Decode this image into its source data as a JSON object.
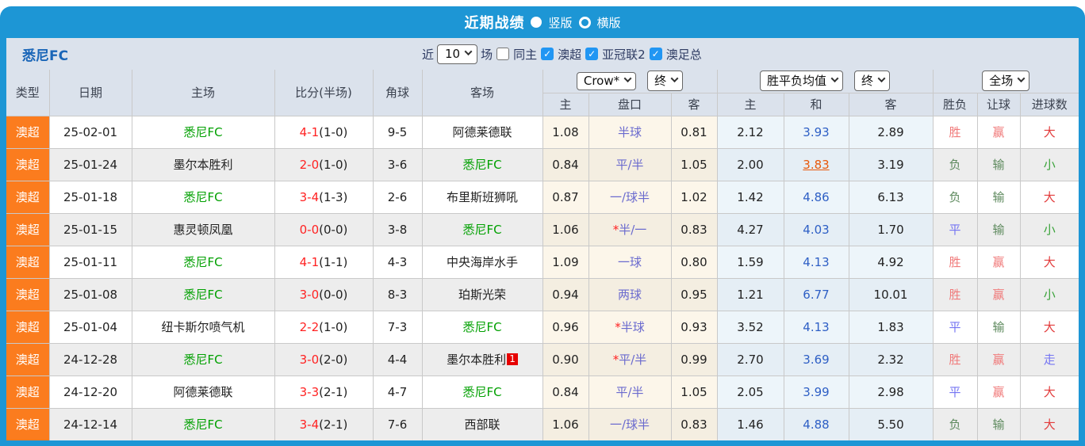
{
  "colors": {
    "frame_blue": "#1d96d5",
    "league_orange": "#fb7c1e",
    "team_green": "#00a000",
    "score_red": "#ff2222",
    "hot_orange": "#e8590c",
    "checkbox_blue": "#2196f3"
  },
  "header": {
    "title": "近期战绩",
    "radios": [
      {
        "label": "竖版",
        "selected": true
      },
      {
        "label": "横版",
        "selected": false
      }
    ]
  },
  "subheader": {
    "team": "悉尼FC",
    "near_label": "近",
    "count_value": "10",
    "games_label": "场",
    "checkboxes": [
      {
        "label": "同主",
        "checked": false
      },
      {
        "label": "澳超",
        "checked": true
      },
      {
        "label": "亚冠联2",
        "checked": true
      },
      {
        "label": "澳足总",
        "checked": true
      }
    ]
  },
  "table": {
    "main_headers": [
      "类型",
      "日期",
      "主场",
      "比分(半场)",
      "角球",
      "客场"
    ],
    "dropdowns": {
      "bookmaker": "Crow*",
      "final_a": "终",
      "avg": "胜平负均值",
      "final_b": "终",
      "scope": "全场"
    },
    "sub_headers": [
      "主",
      "盘口",
      "客",
      "主",
      "和",
      "客",
      "胜负",
      "让球",
      "进球数"
    ],
    "rows": [
      {
        "league": "澳超",
        "date": "25-02-01",
        "home": "悉尼FC",
        "hg": true,
        "score": "4-1",
        "half": "(1-0)",
        "corner": "9-5",
        "away": "阿德莱德联",
        "ag": false,
        "badge": "",
        "hh": "1.08",
        "hcap": "半球",
        "star": false,
        "ha": "0.81",
        "oh": "2.12",
        "od": "3.93",
        "hot": false,
        "oa": "2.89",
        "r1": {
          "t": "胜",
          "c": "r"
        },
        "r2": {
          "t": "赢",
          "c": "r"
        },
        "r3": {
          "t": "大",
          "c": "R"
        }
      },
      {
        "league": "澳超",
        "date": "25-01-24",
        "home": "墨尔本胜利",
        "hg": false,
        "score": "2-0",
        "half": "(1-0)",
        "corner": "3-6",
        "away": "悉尼FC",
        "ag": true,
        "badge": "",
        "hh": "0.84",
        "hcap": "平/半",
        "star": false,
        "ha": "1.05",
        "oh": "2.00",
        "od": "3.83",
        "hot": true,
        "oa": "3.19",
        "r1": {
          "t": "负",
          "c": "g"
        },
        "r2": {
          "t": "输",
          "c": "g"
        },
        "r3": {
          "t": "小",
          "c": "G"
        }
      },
      {
        "league": "澳超",
        "date": "25-01-18",
        "home": "悉尼FC",
        "hg": true,
        "score": "3-4",
        "half": "(1-3)",
        "corner": "2-6",
        "away": "布里斯班狮吼",
        "ag": false,
        "badge": "",
        "hh": "0.87",
        "hcap": "一/球半",
        "star": false,
        "ha": "1.02",
        "oh": "1.42",
        "od": "4.86",
        "hot": false,
        "oa": "6.13",
        "r1": {
          "t": "负",
          "c": "g"
        },
        "r2": {
          "t": "输",
          "c": "g"
        },
        "r3": {
          "t": "大",
          "c": "R"
        }
      },
      {
        "league": "澳超",
        "date": "25-01-15",
        "home": "惠灵顿凤凰",
        "hg": false,
        "score": "0-0",
        "half": "(0-0)",
        "corner": "3-8",
        "away": "悉尼FC",
        "ag": true,
        "badge": "",
        "hh": "1.06",
        "hcap": "半/一",
        "star": true,
        "ha": "0.83",
        "oh": "4.27",
        "od": "4.03",
        "hot": false,
        "oa": "1.70",
        "r1": {
          "t": "平",
          "c": "b"
        },
        "r2": {
          "t": "输",
          "c": "g"
        },
        "r3": {
          "t": "小",
          "c": "G"
        }
      },
      {
        "league": "澳超",
        "date": "25-01-11",
        "home": "悉尼FC",
        "hg": true,
        "score": "4-1",
        "half": "(1-1)",
        "corner": "4-3",
        "away": "中央海岸水手",
        "ag": false,
        "badge": "",
        "hh": "1.09",
        "hcap": "一球",
        "star": false,
        "ha": "0.80",
        "oh": "1.59",
        "od": "4.13",
        "hot": false,
        "oa": "4.92",
        "r1": {
          "t": "胜",
          "c": "r"
        },
        "r2": {
          "t": "赢",
          "c": "r"
        },
        "r3": {
          "t": "大",
          "c": "R"
        }
      },
      {
        "league": "澳超",
        "date": "25-01-08",
        "home": "悉尼FC",
        "hg": true,
        "score": "3-0",
        "half": "(0-0)",
        "corner": "8-3",
        "away": "珀斯光荣",
        "ag": false,
        "badge": "",
        "hh": "0.94",
        "hcap": "两球",
        "star": false,
        "ha": "0.95",
        "oh": "1.21",
        "od": "6.77",
        "hot": false,
        "oa": "10.01",
        "r1": {
          "t": "胜",
          "c": "r"
        },
        "r2": {
          "t": "赢",
          "c": "r"
        },
        "r3": {
          "t": "小",
          "c": "G"
        }
      },
      {
        "league": "澳超",
        "date": "25-01-04",
        "home": "纽卡斯尔喷气机",
        "hg": false,
        "score": "2-2",
        "half": "(1-0)",
        "corner": "7-3",
        "away": "悉尼FC",
        "ag": true,
        "badge": "",
        "hh": "0.96",
        "hcap": "半球",
        "star": true,
        "ha": "0.93",
        "oh": "3.52",
        "od": "4.13",
        "hot": false,
        "oa": "1.83",
        "r1": {
          "t": "平",
          "c": "b"
        },
        "r2": {
          "t": "输",
          "c": "g"
        },
        "r3": {
          "t": "大",
          "c": "R"
        }
      },
      {
        "league": "澳超",
        "date": "24-12-28",
        "home": "悉尼FC",
        "hg": true,
        "score": "3-0",
        "half": "(2-0)",
        "corner": "4-4",
        "away": "墨尔本胜利",
        "ag": false,
        "badge": "1",
        "hh": "0.90",
        "hcap": "平/半",
        "star": true,
        "ha": "0.99",
        "oh": "2.70",
        "od": "3.69",
        "hot": false,
        "oa": "2.32",
        "r1": {
          "t": "胜",
          "c": "r"
        },
        "r2": {
          "t": "赢",
          "c": "r"
        },
        "r3": {
          "t": "走",
          "c": "b"
        }
      },
      {
        "league": "澳超",
        "date": "24-12-20",
        "home": "阿德莱德联",
        "hg": false,
        "score": "3-3",
        "half": "(2-1)",
        "corner": "4-7",
        "away": "悉尼FC",
        "ag": true,
        "badge": "",
        "hh": "0.84",
        "hcap": "平/半",
        "star": false,
        "ha": "1.05",
        "oh": "2.05",
        "od": "3.99",
        "hot": false,
        "oa": "2.98",
        "r1": {
          "t": "平",
          "c": "b"
        },
        "r2": {
          "t": "赢",
          "c": "r"
        },
        "r3": {
          "t": "大",
          "c": "R"
        }
      },
      {
        "league": "澳超",
        "date": "24-12-14",
        "home": "悉尼FC",
        "hg": true,
        "score": "3-4",
        "half": "(2-1)",
        "corner": "7-6",
        "away": "西部联",
        "ag": false,
        "badge": "",
        "hh": "1.06",
        "hcap": "一/球半",
        "star": false,
        "ha": "0.83",
        "oh": "1.46",
        "od": "4.88",
        "hot": false,
        "oa": "5.50",
        "r1": {
          "t": "负",
          "c": "g"
        },
        "r2": {
          "t": "输",
          "c": "g"
        },
        "r3": {
          "t": "大",
          "c": "R"
        }
      }
    ]
  }
}
